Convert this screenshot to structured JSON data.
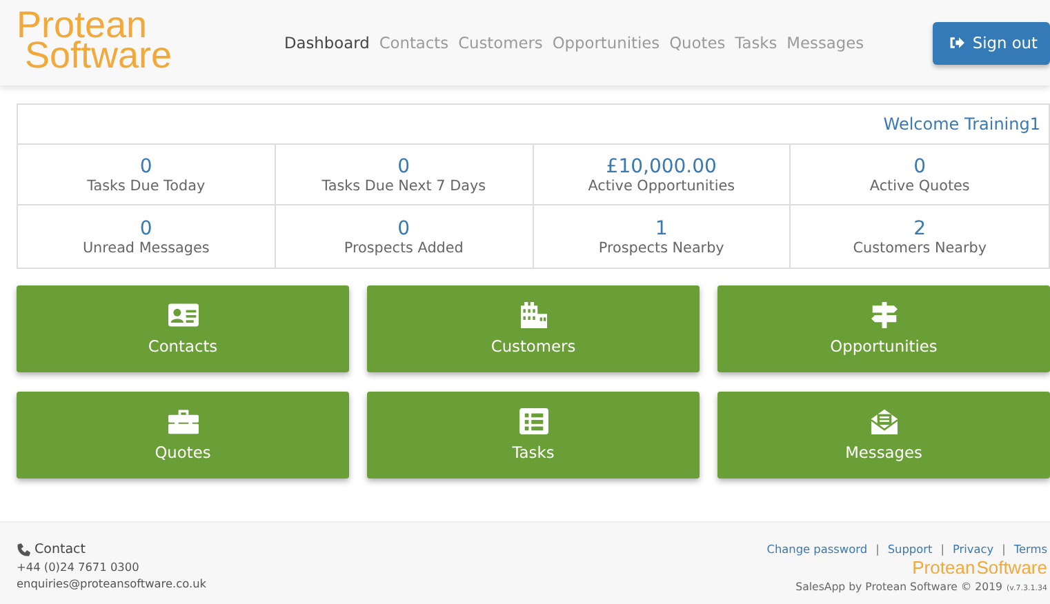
{
  "header": {
    "logo_lines": [
      "Protean",
      "Software"
    ],
    "nav": [
      {
        "label": "Dashboard",
        "selected": true
      },
      {
        "label": "Contacts",
        "selected": false
      },
      {
        "label": "Customers",
        "selected": false
      },
      {
        "label": "Opportunities",
        "selected": false
      },
      {
        "label": "Quotes",
        "selected": false
      },
      {
        "label": "Tasks",
        "selected": false
      },
      {
        "label": "Messages",
        "selected": false
      }
    ],
    "sign_out": "Sign out"
  },
  "welcome": "Welcome Training1",
  "stats": [
    {
      "value": "0",
      "label": "Tasks Due Today"
    },
    {
      "value": "0",
      "label": "Tasks Due Next 7 Days"
    },
    {
      "value": "£10,000.00",
      "label": "Active Opportunities"
    },
    {
      "value": "0",
      "label": "Active Quotes"
    },
    {
      "value": "0",
      "label": "Unread Messages"
    },
    {
      "value": "0",
      "label": "Prospects Added"
    },
    {
      "value": "1",
      "label": "Prospects Nearby"
    },
    {
      "value": "2",
      "label": "Customers Nearby"
    }
  ],
  "tiles": [
    {
      "kind": "contacts",
      "label": "Contacts"
    },
    {
      "kind": "customers",
      "label": "Customers"
    },
    {
      "kind": "opportunities",
      "label": "Opportunities"
    },
    {
      "kind": "quotes",
      "label": "Quotes"
    },
    {
      "kind": "tasks",
      "label": "Tasks"
    },
    {
      "kind": "messages",
      "label": "Messages"
    }
  ],
  "footer": {
    "contact_heading": "Contact",
    "phone": "+44 (0)24 7671 0300",
    "email": "enquiries@proteansoftware.co.uk",
    "links": [
      "Change password",
      "Support",
      "Privacy",
      "Terms"
    ],
    "separator": "|",
    "brand": [
      "Protean",
      "Software"
    ],
    "copyright": "SalesApp by Protean Software © 2019",
    "version": "(v.7.3.1.34"
  }
}
